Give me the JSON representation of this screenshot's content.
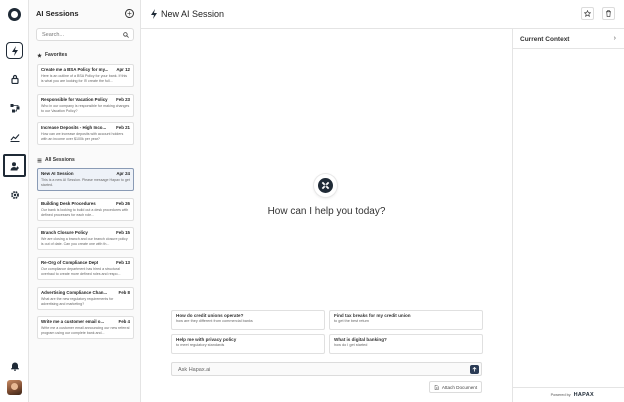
{
  "header": {
    "title": "New AI Session"
  },
  "panel": {
    "title": "AI Sessions",
    "search_placeholder": "Search...",
    "favorites_label": "Favorites",
    "all_label": "All Sessions",
    "favorites": [
      {
        "title": "Create me a BSA Policy for my...",
        "date": "Apr 12",
        "desc": "Here is an outline of a BSA Policy for your bank. If this is what you are looking for I'll create the full..."
      },
      {
        "title": "Responsible for Vacation Policy",
        "date": "Feb 23",
        "desc": "Who in our company is responsible for making changes to our Vacation Policy?"
      },
      {
        "title": "Increase Deposits - High Inco...",
        "date": "Feb 21",
        "desc": "How can we increase deposits with account holders with an income over $100k per year?"
      }
    ],
    "sessions": [
      {
        "title": "New AI Session",
        "date": "Apr 24",
        "desc": "This is a new AI Session. Please message Hapax to get started."
      },
      {
        "title": "Building Desk Procedures",
        "date": "Feb 26",
        "desc": "Our bank is looking to build out a desk procedures with defined processes for each role..."
      },
      {
        "title": "Branch Closure Policy",
        "date": "Feb 15",
        "desc": "We are closing a branch and our branch closure policy is out of date. Can you create one with th..."
      },
      {
        "title": "Re-Org of Compliance Dept",
        "date": "Feb 13",
        "desc": "Our compliance department has hired a structural overhaul to create more defined roles and respo..."
      },
      {
        "title": "Advertising Compliance Chan...",
        "date": "Feb 8",
        "desc": "What are the new regulatory requirements for advertising and marketing?"
      },
      {
        "title": "Write me a customer email o...",
        "date": "Feb 4",
        "desc": "Write me a customer email announcing our new referral program using our complete bank and..."
      }
    ]
  },
  "main": {
    "greeting": "How can I help you today?",
    "suggestions": [
      {
        "title": "How do credit unions operate?",
        "sub": "how are they different from commercial banks"
      },
      {
        "title": "Find tax breaks for my credit union",
        "sub": "to get the best return"
      },
      {
        "title": "Help me with privacy policy",
        "sub": "to meet regulatory standards"
      },
      {
        "title": "What is digital banking?",
        "sub": "how do I get started"
      }
    ],
    "ask_placeholder": "Ask Hapax.ai",
    "attach_label": "Attach Document"
  },
  "context": {
    "title": "Current Context",
    "powered_by": "Powered by",
    "brand": "HAPAX"
  },
  "colors": {
    "accent": "#1f2a36",
    "send": "#2b3b55",
    "selected_card": "#eef2f8"
  }
}
